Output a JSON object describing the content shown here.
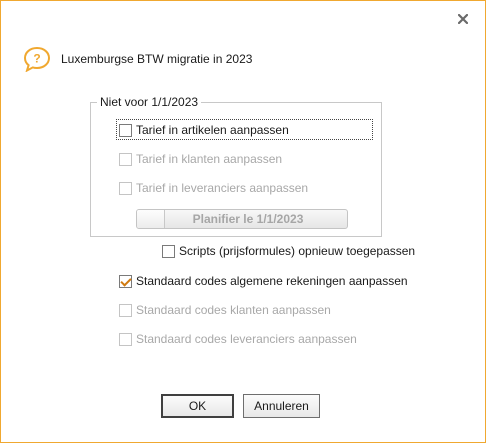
{
  "dialog": {
    "title": "Luxemburgse BTW migratie in 2023",
    "header_icon": "question-bubble-icon",
    "close_icon": "close-icon",
    "accent_color": "#f0a830"
  },
  "group": {
    "legend": "Niet voor 1/1/2023",
    "items": [
      {
        "label": "Tarief in artikelen aanpassen",
        "checked": false,
        "enabled": true
      },
      {
        "label": "Tarief in klanten aanpassen",
        "checked": false,
        "enabled": false
      },
      {
        "label": "Tarief in leveranciers aanpassen",
        "checked": false,
        "enabled": false
      }
    ],
    "plan_button_label": "Planifier le 1/1/2023"
  },
  "options": [
    {
      "label": "Scripts (prijsformules) opnieuw toegepassen",
      "checked": false,
      "enabled": true
    },
    {
      "label": "Standaard codes algemene rekeningen aanpassen",
      "checked": true,
      "enabled": true
    },
    {
      "label": "Standaard codes klanten aanpassen",
      "checked": false,
      "enabled": false
    },
    {
      "label": "Standaard codes leveranciers aanpassen",
      "checked": false,
      "enabled": false
    }
  ],
  "buttons": {
    "ok": "OK",
    "cancel": "Annuleren"
  }
}
